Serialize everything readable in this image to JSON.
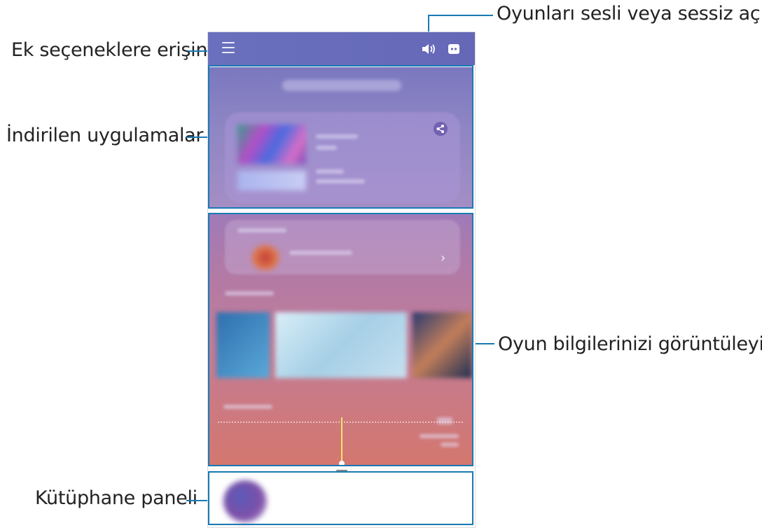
{
  "callouts": {
    "menu": "Ek seçeneklere erişin",
    "downloaded": "İndirilen uygulamalar",
    "library": "Kütüphane paneli",
    "sound": "Oyunları sesli veya sessiz açın",
    "info": "Oyun bilgilerinizi görüntüleyin"
  },
  "phone": {
    "topbar_color": "#6a6fbb",
    "icons": [
      "menu-icon",
      "sound-icon",
      "discord-icon"
    ],
    "upper_panel": {
      "share_icon": "share-icon"
    },
    "lower_panel": {
      "chevron": "›"
    },
    "accent": "#1a7ab3"
  }
}
